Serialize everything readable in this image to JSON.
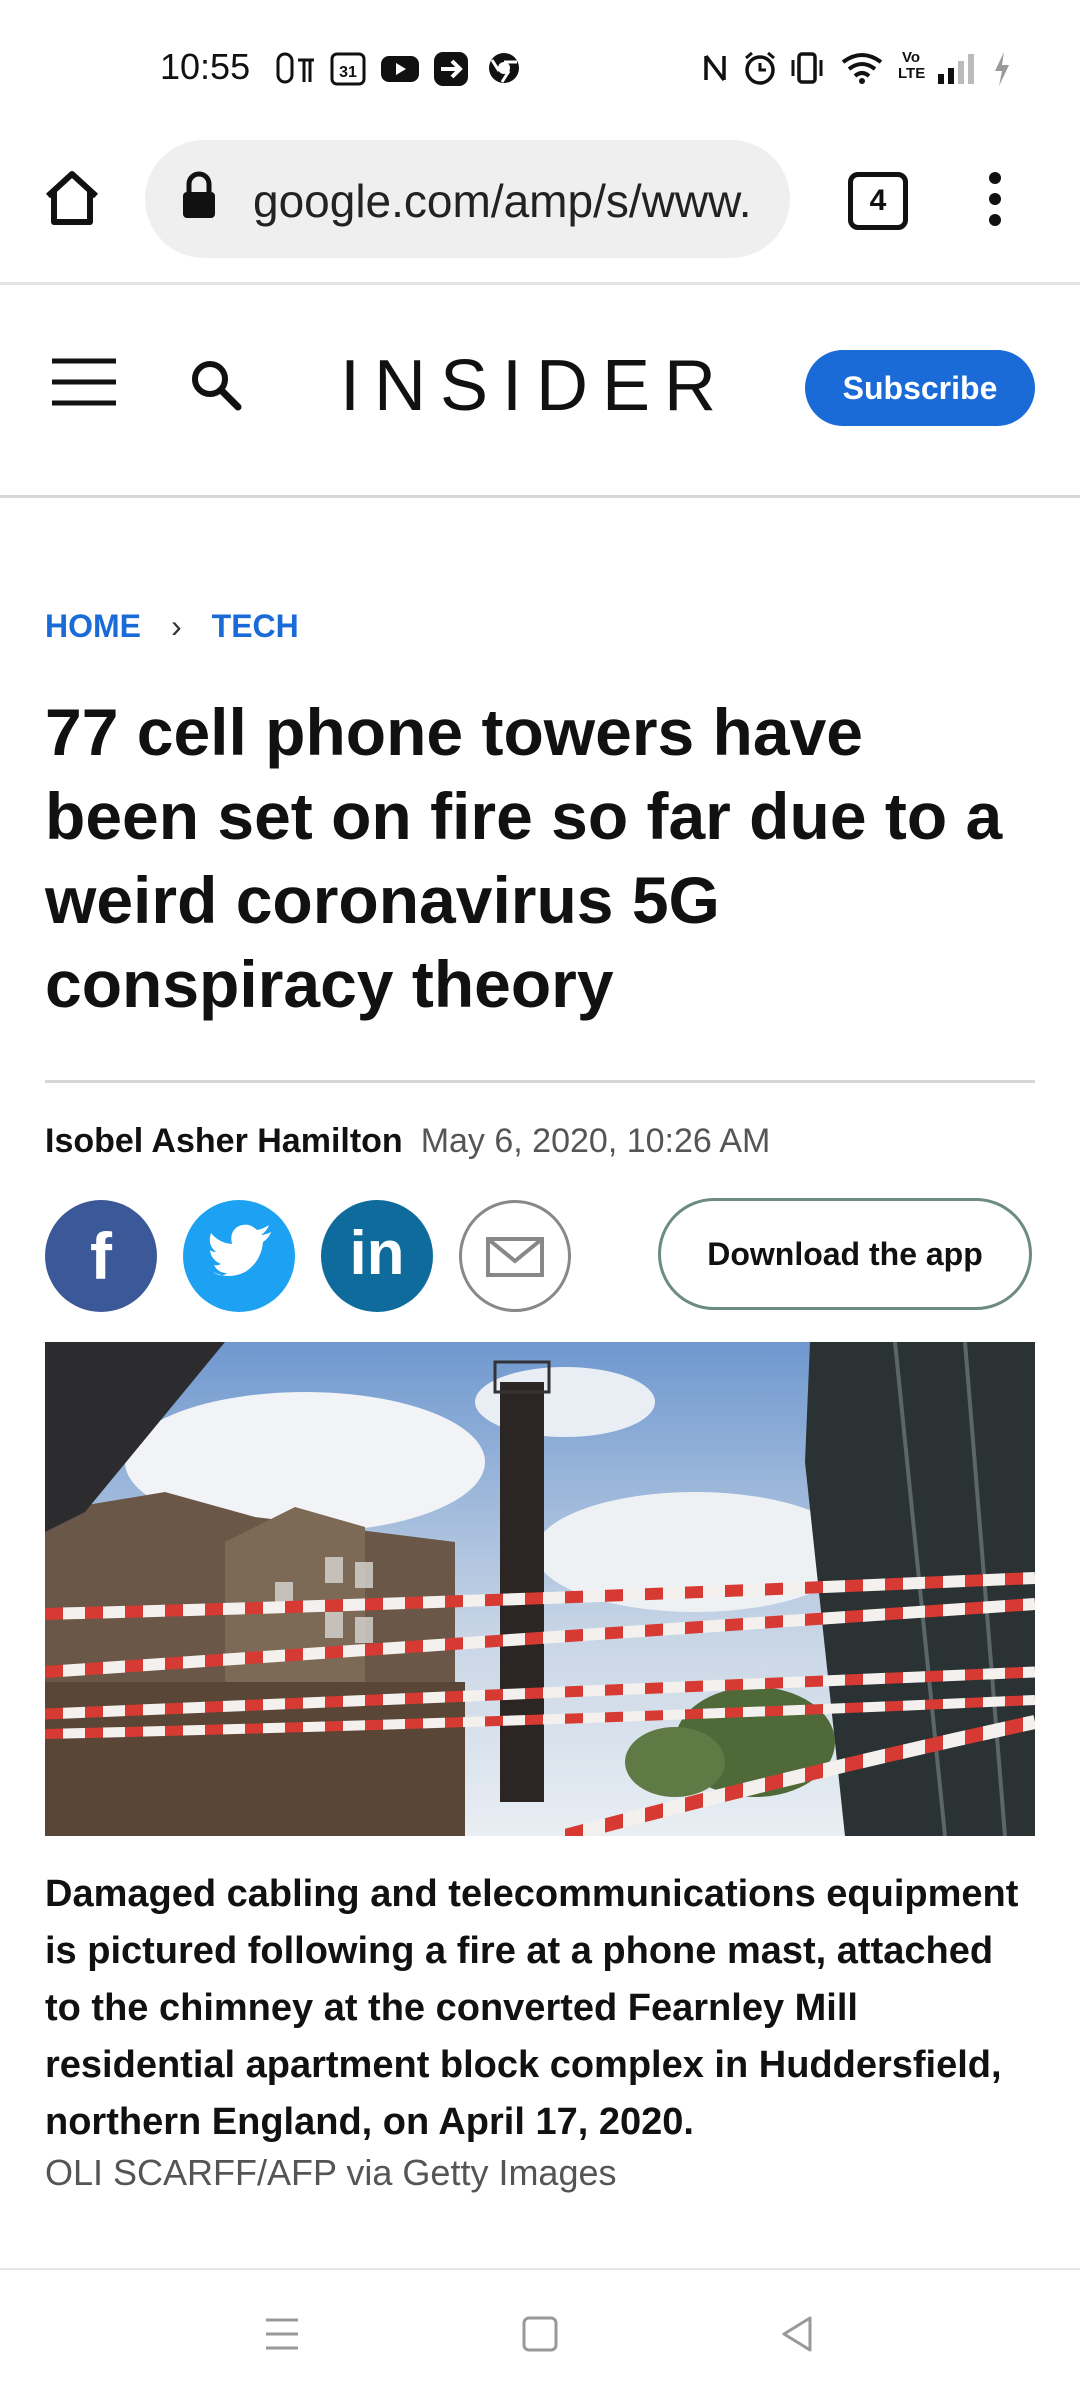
{
  "status_bar": {
    "time": "10:55",
    "icons_left": [
      "signal-app-icon",
      "calendar-icon",
      "youtube-icon",
      "forward-app-icon",
      "chrome-icon"
    ],
    "calendar_day": "31",
    "icons_right": [
      "nfc-icon",
      "alarm-icon",
      "vibrate-icon",
      "wifi-icon",
      "volte-icon",
      "cell-signal-icon",
      "battery-charging-icon"
    ],
    "volte": "Vo LTE"
  },
  "browser": {
    "url": "google.com/amp/s/www.",
    "tab_count": "4"
  },
  "site": {
    "logo": "INSIDER",
    "subscribe_label": "Subscribe",
    "accent_color": "#1a6bd8"
  },
  "article": {
    "breadcrumb": [
      "HOME",
      "TECH"
    ],
    "headline": "77 cell phone towers have been set on fire so far due to a weird coronavirus 5G conspiracy theory",
    "author": "Isobel Asher Hamilton",
    "date": "May 6, 2020, 10:26 AM",
    "share": [
      {
        "name": "facebook",
        "label": "f",
        "color": "#3b5998"
      },
      {
        "name": "twitter",
        "color": "#1da1f2"
      },
      {
        "name": "linkedin",
        "label": "in",
        "color": "#0e6b9c"
      },
      {
        "name": "email"
      }
    ],
    "download_label": "Download the app",
    "caption": "Damaged cabling and telecommunications equipment is pictured following a fire at a phone mast, attached to the chimney at the converted Fearnley Mill residential apartment block complex in Huddersfield, northern England, on April 17, 2020.",
    "credit": "OLI SCARFF/AFP via Getty Images"
  }
}
